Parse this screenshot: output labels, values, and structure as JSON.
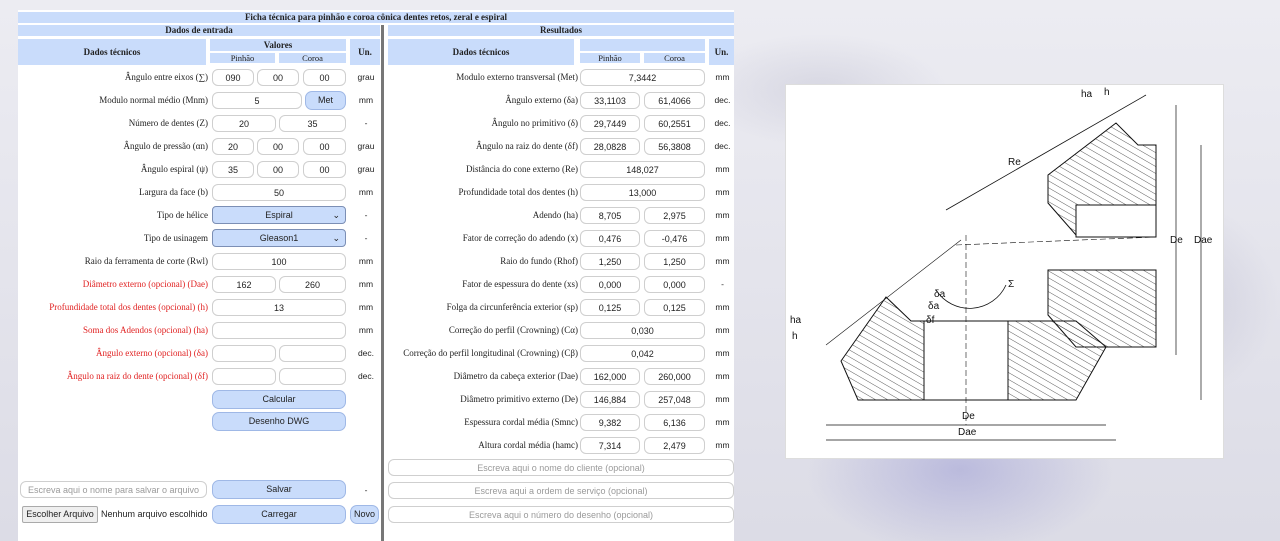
{
  "title": "Ficha técnica para pinhão e coroa cônica dentes retos, zeral e espiral",
  "input_section": {
    "header": "Dados de entrada",
    "col_label": "Dados técnicos",
    "col_values": "Valores",
    "col_pinion": "Pinhão",
    "col_crown": "Coroa",
    "col_unit": "Un.",
    "rows": [
      {
        "label": "Ângulo entre eixos (∑)",
        "v1": "090",
        "v2": "00",
        "v3": "00",
        "unit": "grau"
      },
      {
        "label": "Modulo normal médio (Mnm)",
        "v1": "5",
        "btn": "Met",
        "unit": "mm"
      },
      {
        "label": "Número de dentes (Z)",
        "v1": "20",
        "v2": "35",
        "unit": "-"
      },
      {
        "label": "Ângulo de pressão (αn)",
        "v1": "20",
        "v2": "00",
        "v3": "00",
        "unit": "grau"
      },
      {
        "label": "Ângulo espiral (ψ)",
        "v1": "35",
        "v2": "00",
        "v3": "00",
        "unit": "grau"
      },
      {
        "label": "Largura da face (b)",
        "v1": "50",
        "unit": "mm"
      },
      {
        "label": "Tipo de hélice",
        "select": "Espiral",
        "unit": "-"
      },
      {
        "label": "Tipo de usinagem",
        "select": "Gleason1",
        "unit": "-"
      },
      {
        "label": "Raio da ferramenta de corte (Rwl)",
        "v1": "100",
        "unit": "mm"
      },
      {
        "label": "Diâmetro externo (opcional) (Dae)",
        "v1": "162",
        "v2": "260",
        "unit": "mm"
      },
      {
        "label": "Profundidade total dos dentes (opcional) (h)",
        "v1": "13",
        "unit": "mm"
      },
      {
        "label": "Soma dos Adendos (opcional) (ha)",
        "v1": "",
        "unit": "mm"
      },
      {
        "label": "Ângulo externo (opcional) (δa)",
        "v1": "",
        "v2": "",
        "unit": "dec."
      },
      {
        "label": "Ângulo na raiz do dente (opcional) (δf)",
        "v1": "",
        "v2": "",
        "unit": "dec."
      }
    ],
    "calc_button": "Calcular",
    "dwg_button": "Desenho DWG",
    "save_placeholder": "Escreva aqui o nome para salvar o arquivo",
    "save_button": "Salvar",
    "save_unit": "-",
    "file_button": "Escolher Arquivo",
    "file_status": "Nenhum arquivo escolhido",
    "load_button": "Carregar",
    "new_button": "Novo"
  },
  "result_section": {
    "header": "Resultados",
    "col_label": "Dados técnicos",
    "col_pinion": "Pinhão",
    "col_crown": "Coroa",
    "col_unit": "Un.",
    "rows": [
      {
        "label": "Modulo externo transversal (Met)",
        "single": "7,3442",
        "unit": "mm"
      },
      {
        "label": "Ângulo externo (δa)",
        "v1": "33,1103",
        "v2": "61,4066",
        "unit": "dec."
      },
      {
        "label": "Ângulo no primitivo (δ)",
        "v1": "29,7449",
        "v2": "60,2551",
        "unit": "dec."
      },
      {
        "label": "Ângulo na raiz do dente (δf)",
        "v1": "28,0828",
        "v2": "56,3808",
        "unit": "dec."
      },
      {
        "label": "Distância do cone externo (Re)",
        "single": "148,027",
        "unit": "mm"
      },
      {
        "label": "Profundidade total dos dentes (h)",
        "single": "13,000",
        "unit": "mm"
      },
      {
        "label": "Adendo (ha)",
        "v1": "8,705",
        "v2": "2,975",
        "unit": "mm"
      },
      {
        "label": "Fator de correção do adendo (x)",
        "v1": "0,476",
        "v2": "-0,476",
        "unit": "mm"
      },
      {
        "label": "Raio do fundo (Rhof)",
        "v1": "1,250",
        "v2": "1,250",
        "unit": "mm"
      },
      {
        "label": "Fator de espessura do dente (xs)",
        "v1": "0,000",
        "v2": "0,000",
        "unit": "-"
      },
      {
        "label": "Folga da circunferência exterior (sp)",
        "v1": "0,125",
        "v2": "0,125",
        "unit": "mm"
      },
      {
        "label": "Correção do perfil (Crowning) (Cα)",
        "single": "0,030",
        "unit": "mm"
      },
      {
        "label": "Correção do perfil longitudinal (Crowning) (Cβ)",
        "single": "0,042",
        "unit": "mm"
      },
      {
        "label": "Diâmetro da cabeça exterior (Dae)",
        "v1": "162,000",
        "v2": "260,000",
        "unit": "mm"
      },
      {
        "label": "Diâmetro primitivo externo (De)",
        "v1": "146,884",
        "v2": "257,048",
        "unit": "mm"
      },
      {
        "label": "Espessura cordal média (Smnc)",
        "v1": "9,382",
        "v2": "6,136",
        "unit": "mm"
      },
      {
        "label": "Altura cordal média (hamc)",
        "v1": "7,314",
        "v2": "2,479",
        "unit": "mm"
      }
    ],
    "client_placeholder": "Escreva aqui o nome do cliente (opcional)",
    "order_placeholder": "Escreva aqui a ordem de serviço (opcional)",
    "drawing_placeholder": "Escreva aqui o número do desenho (opcional)"
  },
  "diagram": {
    "labels": {
      "ha": "ha",
      "h": "h",
      "re": "Re",
      "de": "De",
      "dae": "Dae",
      "sigma": "Σ",
      "delta_a": "δa",
      "delta": "δa",
      "delta_f": "δf"
    }
  }
}
